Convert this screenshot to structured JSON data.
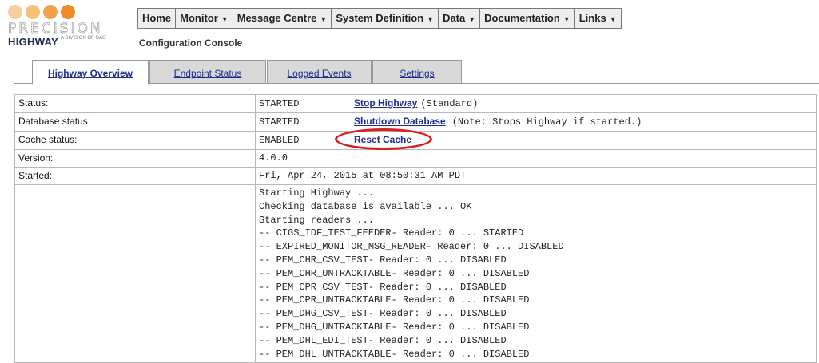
{
  "logo": {
    "dot_colors": [
      "#f6cf9e",
      "#f7c07a",
      "#f2a24e",
      "#f08a2a"
    ],
    "wordmark": "PRECISION",
    "brand": "HIGHWAY",
    "tagline": "A DIVISION OF GAO",
    "icon": "precision-highway-logo"
  },
  "header": {
    "subtitle": "Configuration Console"
  },
  "menu": [
    {
      "label": "Home",
      "dropdown": false
    },
    {
      "label": "Monitor",
      "dropdown": true
    },
    {
      "label": "Message Centre",
      "dropdown": true
    },
    {
      "label": "System Definition",
      "dropdown": true
    },
    {
      "label": "Data",
      "dropdown": true
    },
    {
      "label": "Documentation",
      "dropdown": true
    },
    {
      "label": "Links",
      "dropdown": true
    }
  ],
  "tabs": [
    {
      "label": "Highway Overview",
      "active": true
    },
    {
      "label": "Endpoint Status",
      "active": false
    },
    {
      "label": "Logged Events",
      "active": false
    },
    {
      "label": "Settings",
      "active": false
    }
  ],
  "overview": {
    "status": {
      "label": "Status:",
      "value": "STARTED",
      "action": "Stop Highway",
      "note": "(Standard)"
    },
    "database": {
      "label": "Database status:",
      "value": "STARTED",
      "action": "Shutdown Database",
      "note": "(Note: Stops Highway if started.)"
    },
    "cache": {
      "label": "Cache status:",
      "value": "ENABLED",
      "action": "Reset Cache"
    },
    "version": {
      "label": "Version:",
      "value": "4.0.0"
    },
    "started": {
      "label": "Started:",
      "value": "Fri, Apr 24, 2015 at 08:50:31 AM PDT"
    }
  },
  "startup_log": [
    "Starting Highway ...",
    "Checking database is available ... OK",
    "Starting readers ...",
    "-- CIGS_IDF_TEST_FEEDER- Reader: 0 ... STARTED",
    "-- EXPIRED_MONITOR_MSG_READER- Reader: 0 ... DISABLED",
    "-- PEM_CHR_CSV_TEST- Reader: 0 ... DISABLED",
    "-- PEM_CHR_UNTRACKTABLE- Reader: 0 ... DISABLED",
    "-- PEM_CPR_CSV_TEST- Reader: 0 ... DISABLED",
    "-- PEM_CPR_UNTRACKTABLE- Reader: 0 ... DISABLED",
    "-- PEM_DHG_CSV_TEST- Reader: 0 ... DISABLED",
    "-- PEM_DHG_UNTRACKTABLE- Reader: 0 ... DISABLED",
    "-- PEM_DHL_EDI_TEST- Reader: 0 ... DISABLED",
    "-- PEM_DHL_UNTRACKTABLE- Reader: 0 ... DISABLED"
  ],
  "annotation": {
    "color": "#d8201f",
    "target": "Reset Cache"
  }
}
